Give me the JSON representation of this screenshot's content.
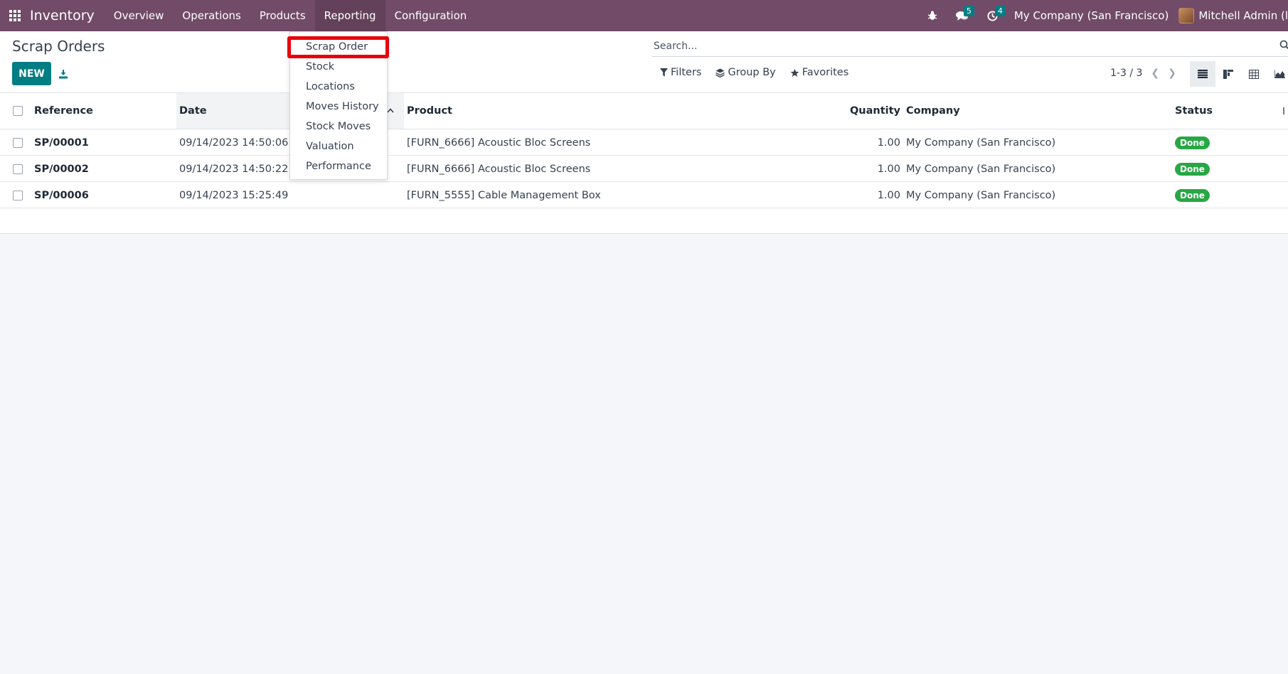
{
  "navbar": {
    "app_name": "Inventory",
    "menu": [
      "Overview",
      "Operations",
      "Products",
      "Reporting",
      "Configuration"
    ],
    "active_menu": "Reporting",
    "messages_count": "5",
    "activities_count": "4",
    "company": "My Company (San Francisco)",
    "user": "Mitchell Admin (l"
  },
  "control": {
    "title": "Scrap Orders",
    "new_label": "NEW",
    "search_placeholder": "Search...",
    "filters_label": "Filters",
    "groupby_label": "Group By",
    "favorites_label": "Favorites",
    "pager": "1-3 / 3"
  },
  "dropdown": {
    "items": [
      "Scrap Order",
      "Stock",
      "Locations",
      "Moves History",
      "Stock Moves",
      "Valuation",
      "Performance"
    ],
    "highlighted": "Scrap Order"
  },
  "table": {
    "headers": {
      "reference": "Reference",
      "date": "Date",
      "product": "Product",
      "quantity": "Quantity",
      "company": "Company",
      "status": "Status"
    },
    "rows": [
      {
        "reference": "SP/00001",
        "date": "09/14/2023 14:50:06",
        "product": "[FURN_6666] Acoustic Bloc Screens",
        "quantity": "1.00",
        "company": "My Company (San Francisco)",
        "status": "Done"
      },
      {
        "reference": "SP/00002",
        "date": "09/14/2023 14:50:22",
        "product": "[FURN_6666] Acoustic Bloc Screens",
        "quantity": "1.00",
        "company": "My Company (San Francisco)",
        "status": "Done"
      },
      {
        "reference": "SP/00006",
        "date": "09/14/2023 15:25:49",
        "product": "[FURN_5555] Cable Management Box",
        "quantity": "1.00",
        "company": "My Company (San Francisco)",
        "status": "Done"
      }
    ]
  },
  "colors": {
    "navbar": "#714b67",
    "primary_button": "#017e84",
    "status_done": "#28a745",
    "highlight_box": "#e8000b"
  }
}
